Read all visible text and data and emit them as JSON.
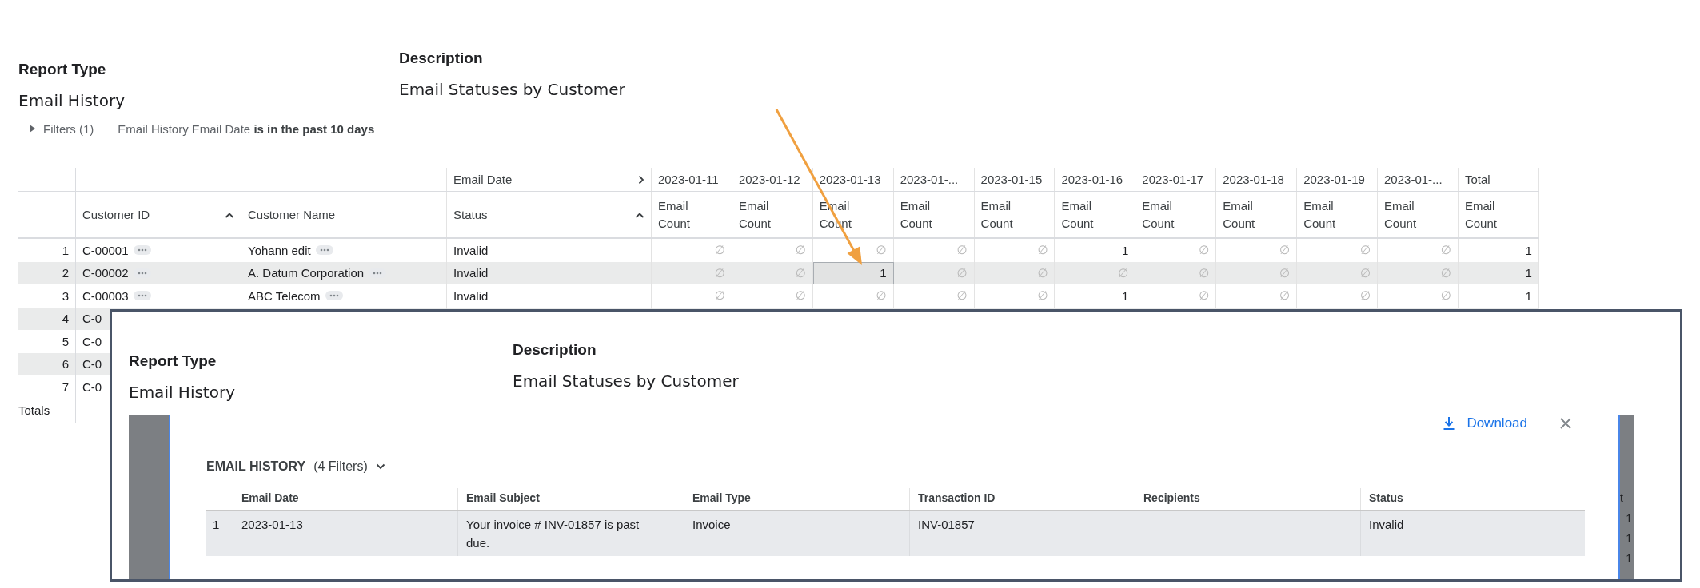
{
  "report": {
    "type_label": "Report Type",
    "type": "Email History",
    "description_label": "Description",
    "description": "Email Statuses by Customer"
  },
  "filters": {
    "label": "Filters (1)",
    "expanded": false,
    "summary": "Email History Email Date **is in the past 10 days**"
  },
  "pivot": {
    "group_header": "Email Date",
    "columns": [
      {
        "label": "Customer ID",
        "sorted": true
      },
      {
        "label": "Customer Name",
        "sorted": false
      },
      {
        "label": "Status",
        "sorted": true
      }
    ],
    "date_columns": [
      {
        "date": "2023-01-11",
        "measure": "Email Count"
      },
      {
        "date": "2023-01-12",
        "measure": "Email Count"
      },
      {
        "date": "2023-01-13",
        "measure": "Email Count"
      },
      {
        "date": "2023-01-...",
        "measure": "Email Count"
      },
      {
        "date": "2023-01-15",
        "measure": "Email Count"
      },
      {
        "date": "2023-01-16",
        "measure": "Email Count"
      },
      {
        "date": "2023-01-17",
        "measure": "Email Count"
      },
      {
        "date": "2023-01-18",
        "measure": "Email Count"
      },
      {
        "date": "2023-01-19",
        "measure": "Email Count"
      },
      {
        "date": "2023-01-...",
        "measure": "Email Count"
      },
      {
        "date": "Total",
        "measure": "Email Count"
      }
    ],
    "rows": [
      {
        "number": "1",
        "customer_id": "C-00001",
        "customer_name": "Yohann edit",
        "status": "Invalid",
        "cells": [
          {
            "value": "∅",
            "selected": false
          },
          {
            "value": "∅",
            "selected": false
          },
          {
            "value": "∅",
            "selected": false
          },
          {
            "value": "∅",
            "selected": false
          },
          {
            "value": "∅",
            "selected": false
          },
          {
            "value": "1",
            "selected": false
          },
          {
            "value": "∅",
            "selected": false
          },
          {
            "value": "∅",
            "selected": false
          },
          {
            "value": "∅",
            "selected": false
          },
          {
            "value": "∅",
            "selected": false
          },
          {
            "value": "1",
            "selected": false
          }
        ]
      },
      {
        "number": "2",
        "customer_id": "C-00002",
        "customer_name": "A. Datum Corporation",
        "status": "Invalid",
        "cells": [
          {
            "value": "∅",
            "selected": false
          },
          {
            "value": "∅",
            "selected": false
          },
          {
            "value": "1",
            "selected": true
          },
          {
            "value": "∅",
            "selected": false
          },
          {
            "value": "∅",
            "selected": false
          },
          {
            "value": "∅",
            "selected": false
          },
          {
            "value": "∅",
            "selected": false
          },
          {
            "value": "∅",
            "selected": false
          },
          {
            "value": "∅",
            "selected": false
          },
          {
            "value": "∅",
            "selected": false
          },
          {
            "value": "1",
            "selected": false
          }
        ]
      },
      {
        "number": "3",
        "customer_id": "C-00003",
        "customer_name": "ABC Telecom",
        "status": "Invalid",
        "cells": [
          {
            "value": "∅",
            "selected": false
          },
          {
            "value": "∅",
            "selected": false
          },
          {
            "value": "∅",
            "selected": false
          },
          {
            "value": "∅",
            "selected": false
          },
          {
            "value": "∅",
            "selected": false
          },
          {
            "value": "1",
            "selected": false
          },
          {
            "value": "∅",
            "selected": false
          },
          {
            "value": "∅",
            "selected": false
          },
          {
            "value": "∅",
            "selected": false
          },
          {
            "value": "∅",
            "selected": false
          },
          {
            "value": "1",
            "selected": false
          }
        ]
      },
      {
        "number": "4",
        "customer_id": "C-0"
      },
      {
        "number": "5",
        "customer_id": "C-0"
      },
      {
        "number": "6",
        "customer_id": "C-0"
      },
      {
        "number": "7",
        "customer_id": "C-0"
      }
    ],
    "totals_label": "Totals"
  },
  "inset": {
    "report": {
      "type_label": "Report Type",
      "type": "Email History",
      "description_label": "Description",
      "description": "Email Statuses by Customer"
    },
    "modal": {
      "title": "EMAIL HISTORY",
      "filter_count": "(4 Filters)",
      "download": "Download",
      "columns": [
        "Email Date",
        "Email Subject",
        "Email Type",
        "Transaction ID",
        "Recipients",
        "Status"
      ],
      "rows": [
        {
          "number": "1",
          "cells": [
            "2023-01-13",
            "Your invoice # INV-01857 is past due.",
            "Invoice",
            "INV-01857",
            "",
            "Invalid"
          ]
        }
      ]
    },
    "backdrop": {
      "column_header": "t",
      "values": [
        "1",
        "1",
        "1"
      ]
    }
  }
}
